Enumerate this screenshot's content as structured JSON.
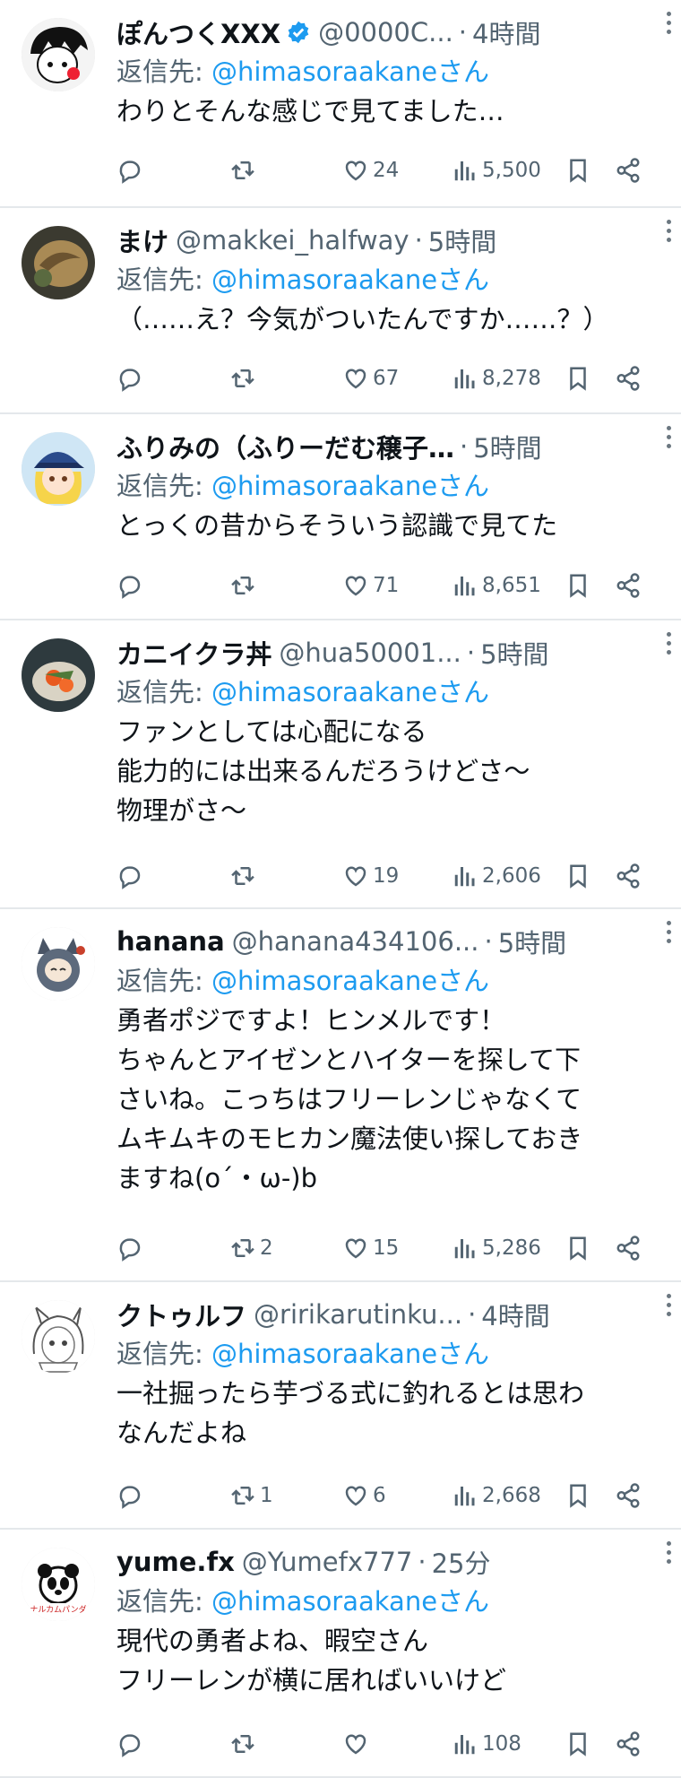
{
  "reply_prefix": "返信先: ",
  "mention": "@himasoraakaneさん",
  "tweets": [
    {
      "name": "ぽんつくXXX",
      "verified": true,
      "handle": "@0000C...",
      "time": "4時間",
      "text": "わりとそんな感じで見てました…",
      "replies": "",
      "retweets": "",
      "likes": "24",
      "views": "5,500"
    },
    {
      "name": "まけ",
      "verified": false,
      "handle": "@makkei_halfway",
      "time": "5時間",
      "text": "（……え？今気がついたんですか……？）",
      "replies": "",
      "retweets": "",
      "likes": "67",
      "views": "8,278"
    },
    {
      "name": "ふりみの（ふりーだむ穣子…",
      "verified": false,
      "handle": "",
      "time": "5時間",
      "text": "とっくの昔からそういう認識で見てた",
      "replies": "",
      "retweets": "",
      "likes": "71",
      "views": "8,651"
    },
    {
      "name": "カニイクラ丼",
      "verified": false,
      "handle": "@hua50001...",
      "time": "5時間",
      "text": "ファンとしては心配になる\n能力的には出来るんだろうけどさ～\n物理がさ～",
      "replies": "",
      "retweets": "",
      "likes": "19",
      "views": "2,606"
    },
    {
      "name": "hanana",
      "verified": false,
      "handle": "@hanana434106...",
      "time": "5時間",
      "text": "勇者ポジですよ！ヒンメルです！\nちゃんとアイゼンとハイターを探して下\nさいね。こっちはフリーレンじゃなくて\nムキムキのモヒカン魔法使い探しておき\nますね(o´・ω-)b",
      "replies": "",
      "retweets": "2",
      "likes": "15",
      "views": "5,286"
    },
    {
      "name": "クトゥルフ",
      "verified": false,
      "handle": "@ririkarutinku...",
      "time": "4時間",
      "text": "一社掘ったら芋づる式に釣れるとは思わ\nなんだよね",
      "replies": "",
      "retweets": "1",
      "likes": "6",
      "views": "2,668"
    },
    {
      "name": "yume.fx",
      "verified": false,
      "handle": "@Yumefx777",
      "time": "25分",
      "text": "現代の勇者よね、暇空さん\nフリーレンが横に居ればいいけど",
      "replies": "",
      "retweets": "",
      "likes": "",
      "views": "108"
    }
  ],
  "colors": {
    "accent": "#1d9bf0",
    "secondary": "#536471",
    "text": "#0f1419",
    "divider": "#e4e8eb"
  },
  "icons": {
    "reply": "speech-bubble-icon",
    "retweet": "retweet-icon",
    "like": "heart-icon",
    "views": "bar-chart-icon",
    "bookmark": "bookmark-icon",
    "share": "share-icon",
    "more": "more-vertical-icon"
  }
}
